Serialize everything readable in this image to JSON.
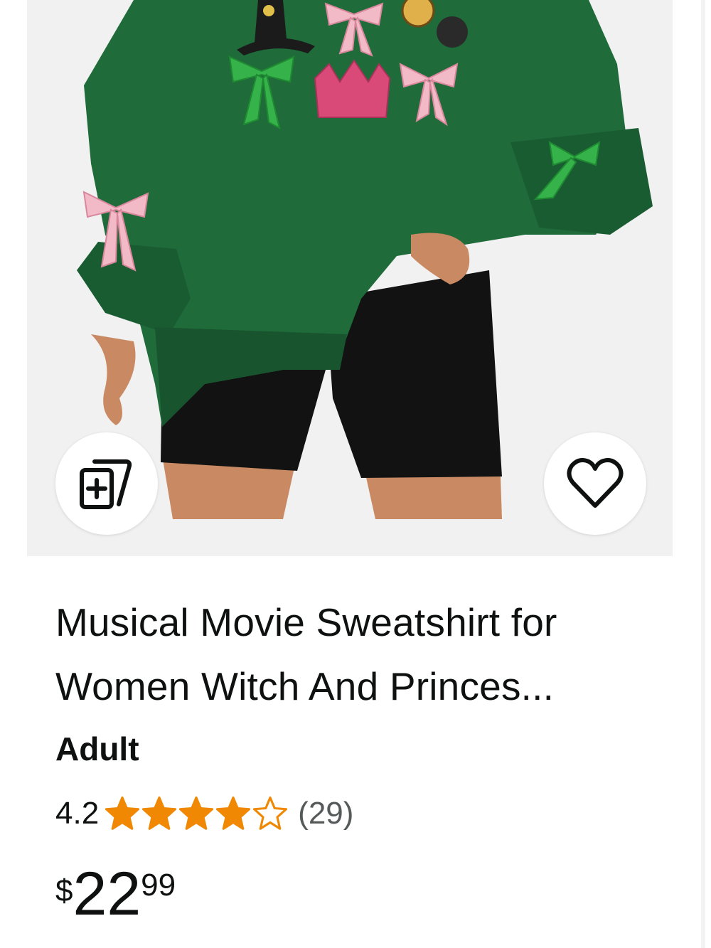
{
  "product": {
    "title": "Musical Movie Sweatshirt for Women Witch And Princes...",
    "variant": "Adult",
    "rating": {
      "value": "4.2",
      "stars": 4.2,
      "count": "(29)"
    },
    "price": {
      "symbol": "$",
      "whole": "22",
      "fraction": "99"
    }
  },
  "icons": {
    "compare": "add-to-compare-icon",
    "wishlist": "heart-icon",
    "star": "star-icon"
  },
  "colors": {
    "sweatshirt": "#1f6b3a",
    "star_fill": "#f08804",
    "text": "#0f1111",
    "muted": "#565959",
    "image_bg": "#f1f1f1"
  }
}
